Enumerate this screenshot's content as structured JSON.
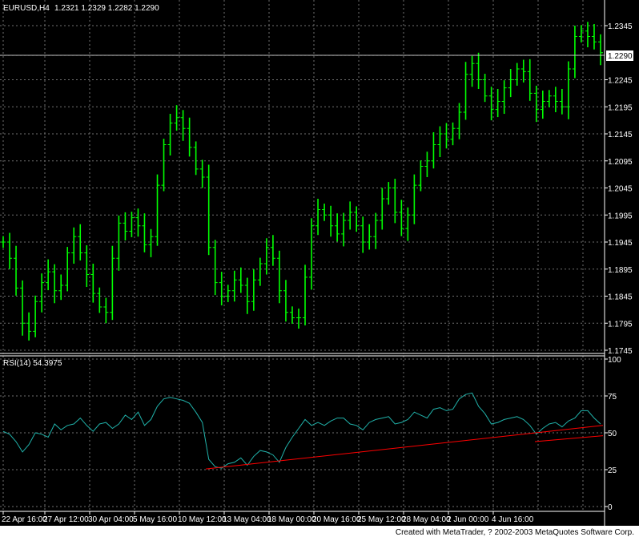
{
  "window": {
    "symbol_header": "EURUSD,H4",
    "ohlc": "1.2321 1.2329 1.2282 1.2290",
    "current_price_label": "1.2290",
    "footer": "Created with MetaTrader, ? 2002-2003 MetaQuotes Software Corp."
  },
  "colors": {
    "background": "#000000",
    "grid": "#707070",
    "candles": "#00ff00",
    "rsi_line": "#20b2aa",
    "trendline": "#ff0000",
    "axis_text": "#ffffff",
    "current_price_line": "#c0c0c0"
  },
  "chart_data": [
    {
      "type": "line",
      "title": "EURUSD,H4",
      "y_ticks": [
        "1.2345",
        "1.2290",
        "1.2245",
        "1.2195",
        "1.2145",
        "1.2095",
        "1.2045",
        "1.1995",
        "1.1945",
        "1.1895",
        "1.1845",
        "1.1795",
        "1.1745"
      ],
      "ylim": [
        1.1745,
        1.2345
      ],
      "x_ticks": [
        "22 Apr 16:00",
        "27 Apr 12:00",
        "30 Apr 04:00",
        "5 May 16:00",
        "10 May 12:00",
        "13 May 04:00",
        "18 May 00:00",
        "20 May 16:00",
        "25 May 12:00",
        "28 May 04:00",
        "2 Jun 00:00",
        "4 Jun 16:00"
      ],
      "current_price": 1.229,
      "series": [
        {
          "values": [
            1.1945,
            1.1915,
            1.186,
            1.1795,
            1.178,
            1.1835,
            1.187,
            1.189,
            1.1855,
            1.1865,
            1.1925,
            1.1955,
            1.1925,
            1.1885,
            1.185,
            1.1825,
            1.1815,
            1.1915,
            1.198,
            1.1965,
            1.199,
            1.1975,
            1.194,
            1.1955,
            1.205,
            1.2125,
            1.2165,
            1.2175,
            1.2155,
            1.212,
            1.208,
            1.2065,
            1.1935,
            1.187,
            1.1845,
            1.1855,
            1.1875,
            1.1865,
            1.1835,
            1.1875,
            1.1905,
            1.1935,
            1.1915,
            1.1855,
            1.1815,
            1.1805,
            1.1805,
            1.188,
            1.1975,
            1.2005,
            1.1995,
            1.1975,
            1.196,
            1.1985,
            1.2,
            1.1975,
            1.1945,
            1.1955,
            1.1985,
            1.2025,
            1.2045,
            1.2,
            1.197,
            1.1995,
            1.205,
            1.2085,
            1.2095,
            1.2125,
            1.2145,
            1.2135,
            1.2155,
            1.2185,
            1.2255,
            1.2275,
            1.2245,
            1.2215,
            1.219,
            1.2205,
            1.223,
            1.2245,
            1.2265,
            1.226,
            1.222,
            1.219,
            1.2205,
            1.2215,
            1.2205,
            1.2195,
            1.2265,
            1.2325,
            1.2335,
            1.2325,
            1.2315,
            1.2295
          ]
        }
      ]
    },
    {
      "type": "line",
      "title": "RSI(14) 54.3975",
      "y_ticks": [
        "100",
        "75",
        "50",
        "25",
        "0"
      ],
      "ylim": [
        0,
        100
      ],
      "series": [
        {
          "values": [
            51,
            49,
            44,
            37,
            42,
            50,
            49,
            47,
            56,
            52,
            55,
            56,
            60,
            55,
            51,
            56,
            57,
            53,
            56,
            62,
            59,
            64,
            55,
            59,
            68,
            73,
            74,
            73,
            72,
            70,
            64,
            57,
            32,
            27,
            26,
            29,
            30,
            33,
            28,
            34,
            38,
            37,
            35,
            30,
            40,
            47,
            53,
            59,
            55,
            57,
            55,
            58,
            60,
            60,
            56,
            55,
            52,
            57,
            59,
            60,
            61,
            56,
            57,
            59,
            64,
            62,
            60,
            66,
            67,
            65,
            66,
            73,
            76,
            77,
            68,
            63,
            56,
            57,
            59,
            60,
            61,
            59,
            55,
            49,
            53,
            56,
            57,
            54,
            58,
            60,
            65,
            65,
            60,
            56
          ]
        },
        {
          "values": [
            25.5,
            55
          ]
        },
        {
          "values": [
            44,
            48
          ]
        }
      ]
    }
  ]
}
